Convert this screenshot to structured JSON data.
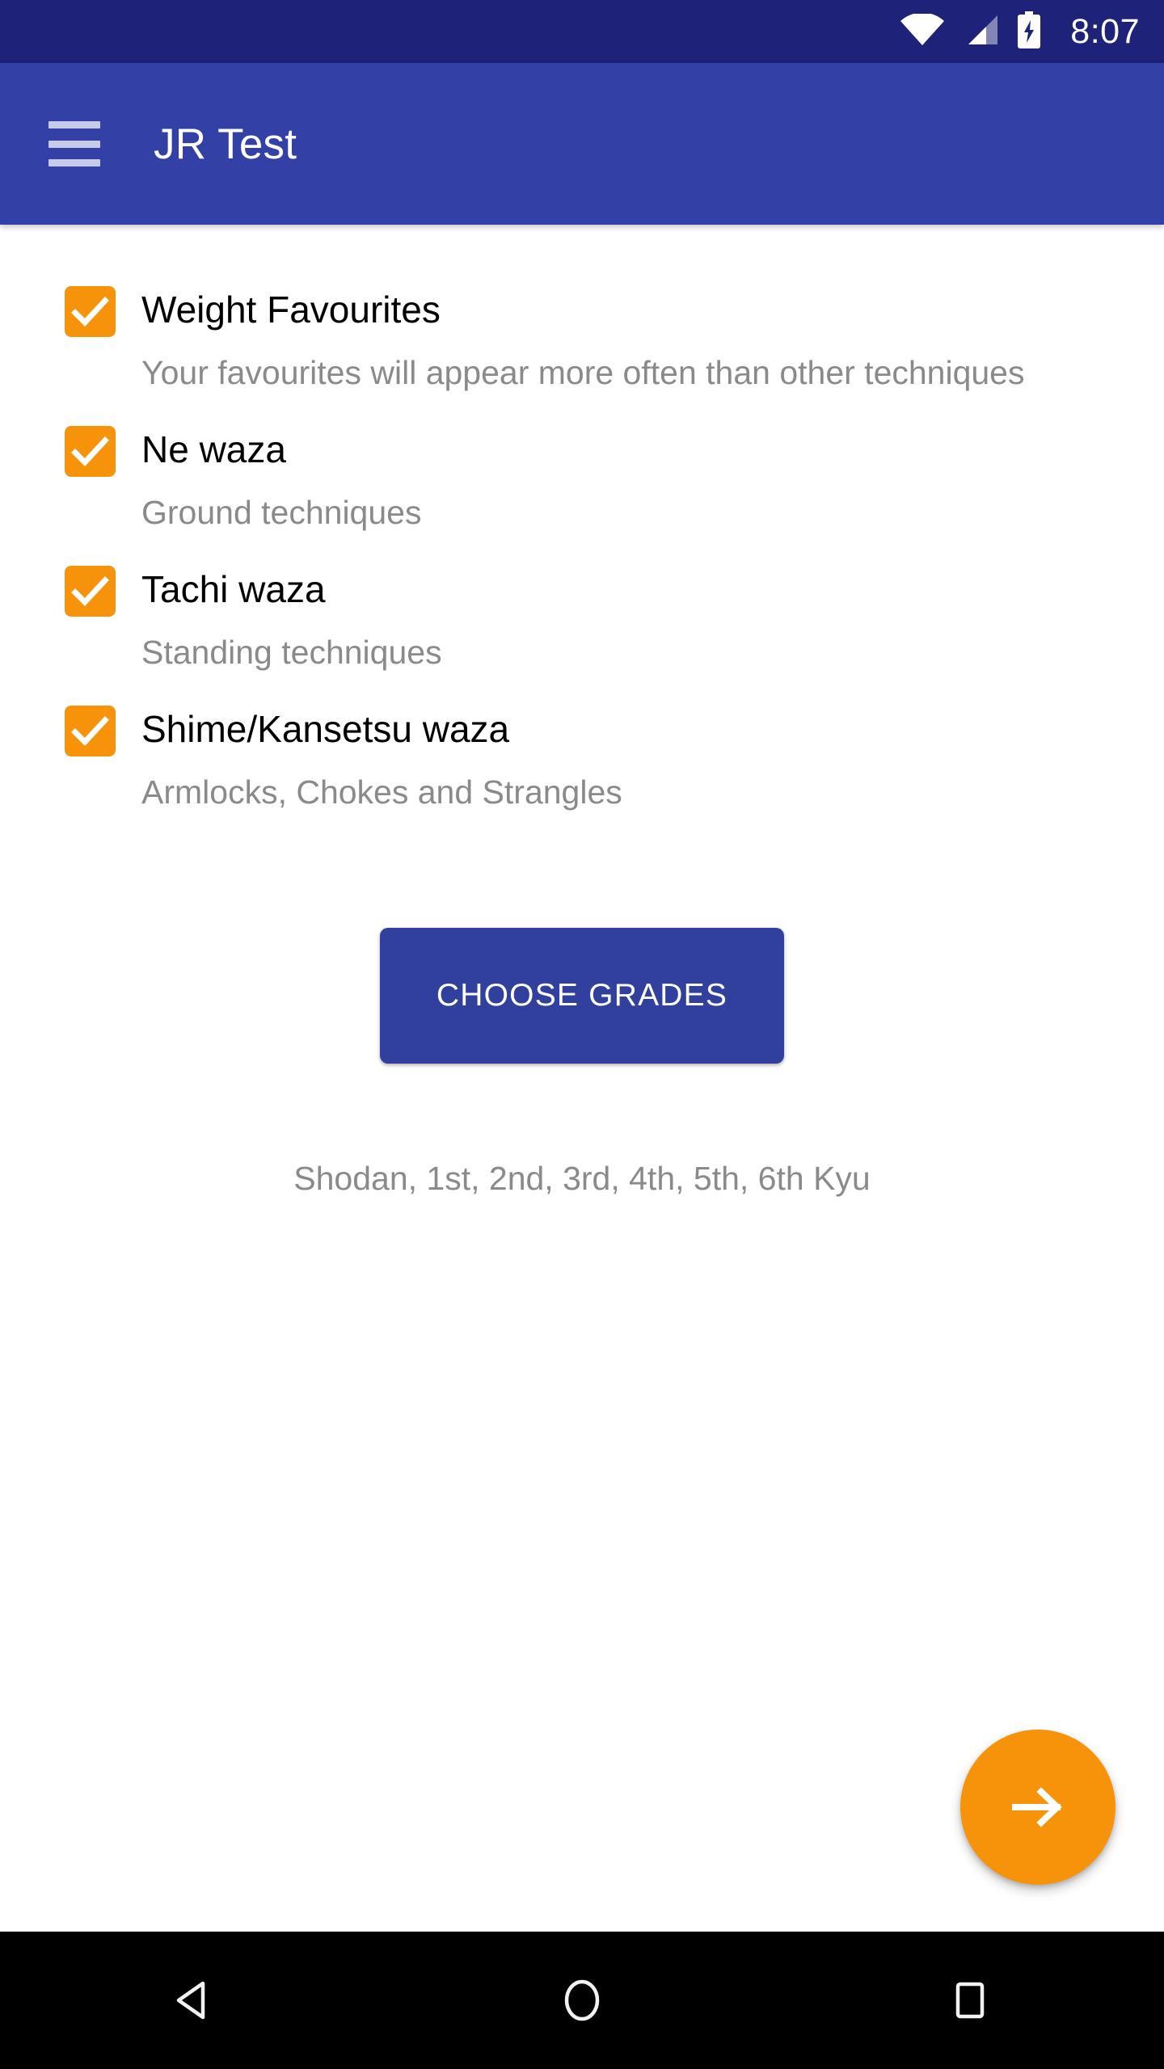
{
  "status_bar": {
    "time": "8:07",
    "icons": [
      "wifi-icon",
      "cellular-signal-icon",
      "battery-charging-icon"
    ],
    "background_color": "#1e2278"
  },
  "app_bar": {
    "menu_icon": "hamburger-menu-icon",
    "title": "JR Test",
    "background_color": "#3340a5",
    "title_color": "#ffffff"
  },
  "theme": {
    "accent_orange": "#f7930a",
    "primary_blue": "#3340a5",
    "button_blue": "#30409c",
    "muted_text": "#8a8a8a"
  },
  "options": [
    {
      "label": "Weight Favourites",
      "description": "Your favourites will appear more often than other techniques",
      "checked": true
    },
    {
      "label": "Ne waza",
      "description": "Ground techniques",
      "checked": true
    },
    {
      "label": "Tachi waza",
      "description": "Standing techniques",
      "checked": true
    },
    {
      "label": "Shime/Kansetsu waza",
      "description": "Armlocks, Chokes and Strangles",
      "checked": true
    }
  ],
  "choose_grades": {
    "label": "CHOOSE GRADES",
    "selected_summary": "Shodan, 1st, 2nd, 3rd, 4th, 5th, 6th Kyu"
  },
  "fab": {
    "icon": "arrow-right-icon",
    "color": "#f7930a"
  },
  "nav_bar": {
    "back": "back-triangle-icon",
    "home": "home-circle-icon",
    "recents": "recents-square-icon",
    "background_color": "#000000"
  }
}
